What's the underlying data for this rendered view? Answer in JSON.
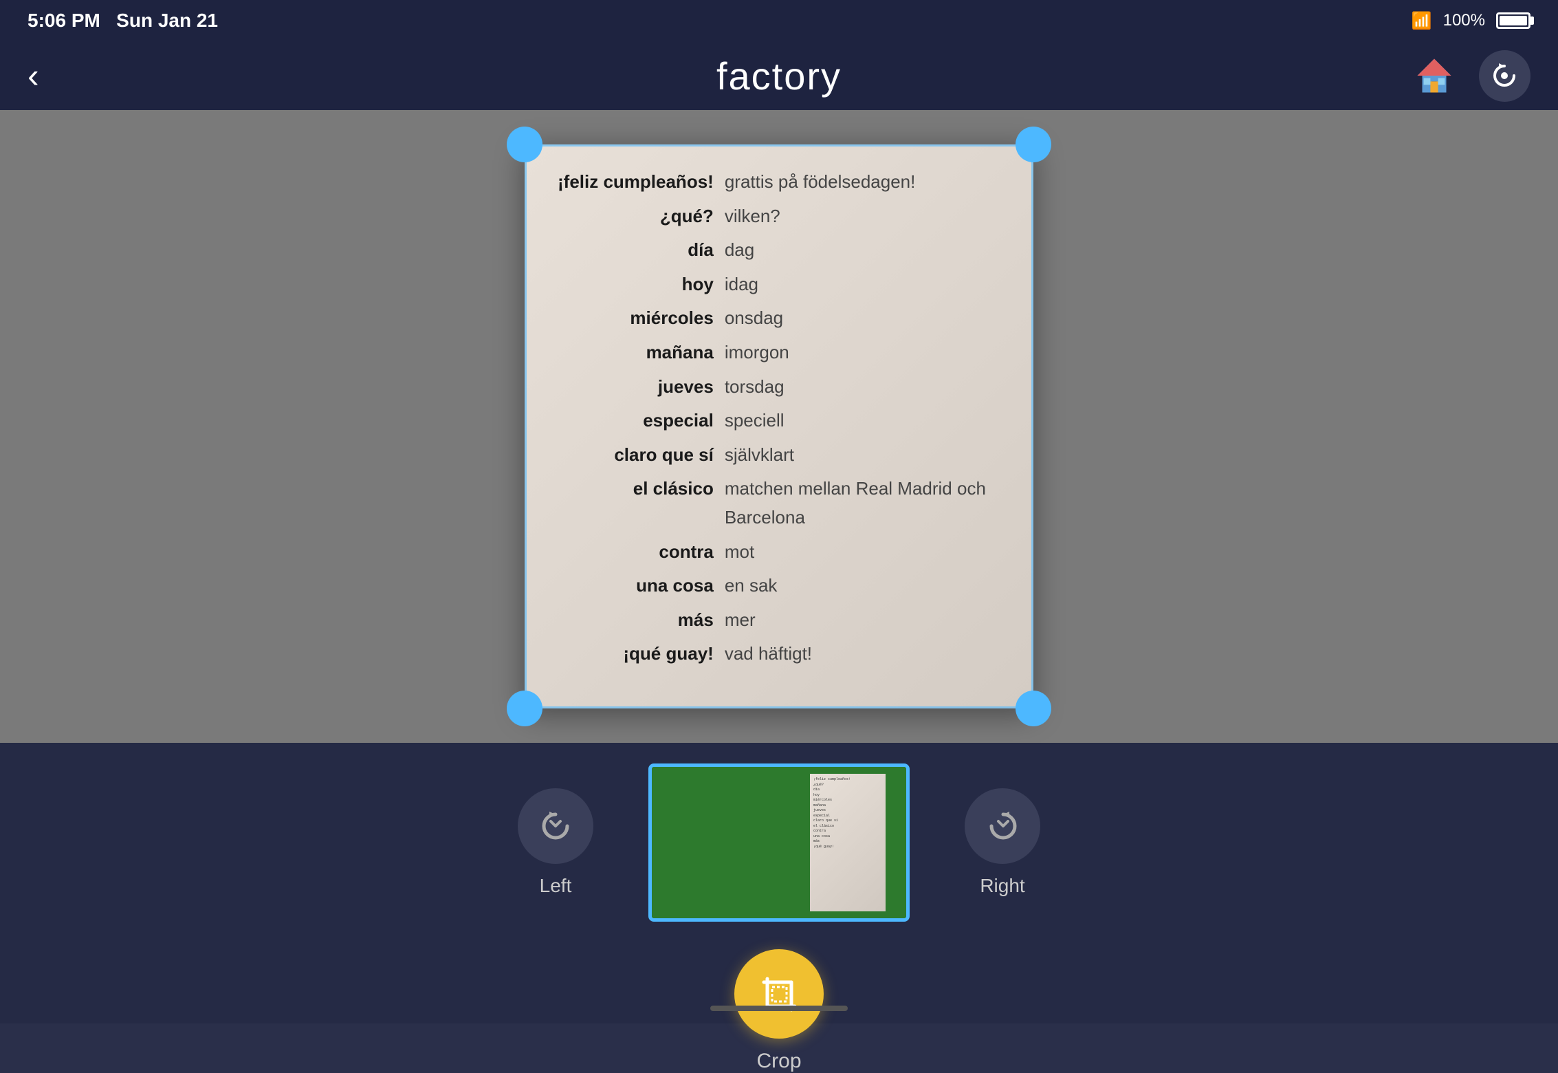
{
  "statusBar": {
    "time": "5:06 PM",
    "date": "Sun Jan 21",
    "battery": "100%"
  },
  "header": {
    "title": "factory",
    "backLabel": "‹"
  },
  "document": {
    "rows": [
      {
        "spanish": "¡feliz cumpleaños!",
        "swedish": "grattis på födelsedagen!"
      },
      {
        "spanish": "¿qué?",
        "swedish": "vilken?"
      },
      {
        "spanish": "día",
        "swedish": "dag"
      },
      {
        "spanish": "hoy",
        "swedish": "idag"
      },
      {
        "spanish": "miércoles",
        "swedish": "onsdag"
      },
      {
        "spanish": "mañana",
        "swedish": "imorgon"
      },
      {
        "spanish": "jueves",
        "swedish": "torsdag"
      },
      {
        "spanish": "especial",
        "swedish": "speciell"
      },
      {
        "spanish": "claro que sí",
        "swedish": "självklart"
      },
      {
        "spanish": "el clásico",
        "swedish": "matchen mellan Real Madrid och Barcelona"
      },
      {
        "spanish": "contra",
        "swedish": "mot"
      },
      {
        "spanish": "una cosa",
        "swedish": "en sak"
      },
      {
        "spanish": "más",
        "swedish": "mer"
      },
      {
        "spanish": "¡qué guay!",
        "swedish": "vad häftigt!"
      }
    ]
  },
  "toolbar": {
    "leftLabel": "Left",
    "rightLabel": "Right",
    "cropLabel": "Crop"
  }
}
